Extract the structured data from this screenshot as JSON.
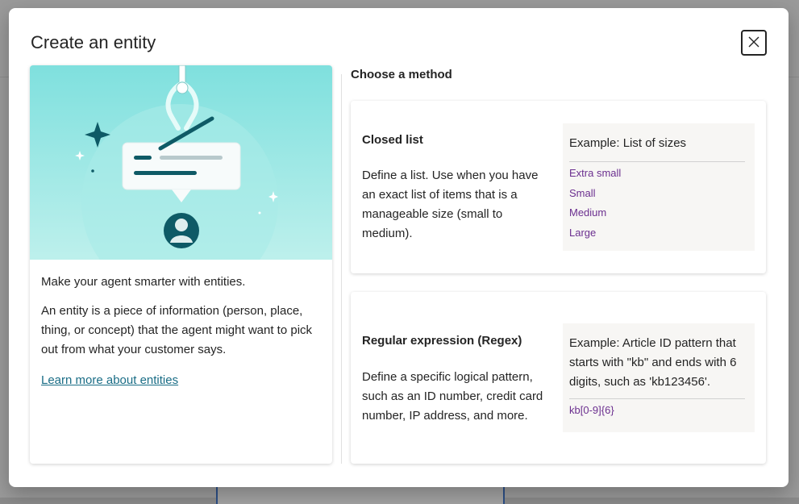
{
  "dialog": {
    "title": "Create an entity",
    "close_icon": "close-icon"
  },
  "left_panel": {
    "illustration": "claw-grabbing-chat-bubble-illustration",
    "intro": "Make your agent smarter with entities.",
    "description": "An entity is a piece of information (person, place, thing, or concept) that the agent might want to pick out from what your customer says.",
    "learn_more": "Learn more about entities"
  },
  "methods": {
    "heading": "Choose a method",
    "items": [
      {
        "title": "Closed list",
        "description": "Define a list. Use when you have an exact list of items that is a manageable size (small to medium).",
        "example_title": "Example: List of sizes",
        "example_items": [
          "Extra small",
          "Small",
          "Medium",
          "Large"
        ]
      },
      {
        "title": "Regular expression (Regex)",
        "description": "Define a specific logical pattern, such as an ID number, credit card number, IP address, and more.",
        "example_title": "Example: Article ID pattern that starts with \"kb\" and ends with 6 digits, such as 'kb123456'.",
        "example_items": [
          "kb[0-9]{6}"
        ]
      }
    ]
  },
  "colors": {
    "accent_teal": "#7fe0de",
    "link": "#1a6d86",
    "example_item": "#6b2f8f"
  }
}
